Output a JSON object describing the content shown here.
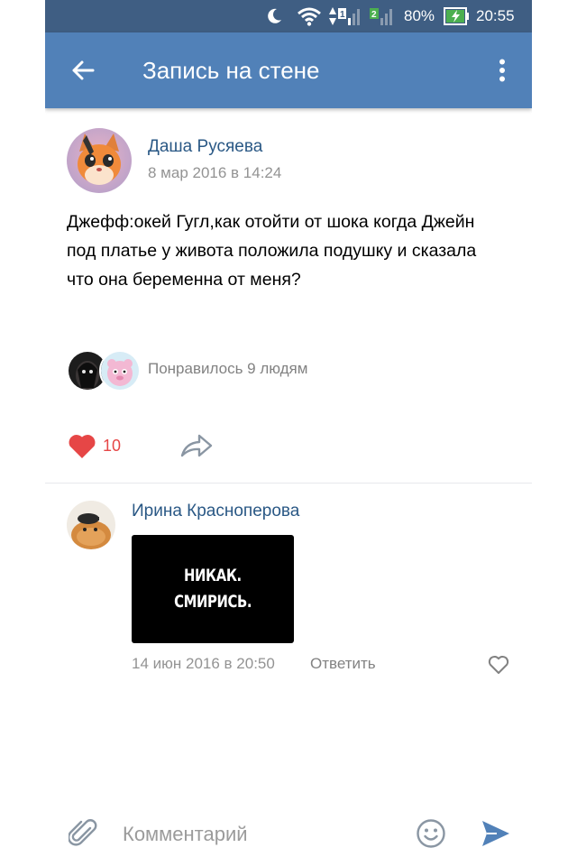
{
  "status_bar": {
    "battery": "80%",
    "time": "20:55"
  },
  "header": {
    "title": "Запись на стене"
  },
  "post": {
    "author": "Даша Русяева",
    "date": "8 мар 2016 в 14:24",
    "text": "Джефф:окей Гугл,как отойти от шока когда Джейн под платье у живота положила подушку и сказала что она беременна от меня?",
    "likes_summary": "Понравилось 9 людям",
    "like_count": "10"
  },
  "comment": {
    "author": "Ирина Красноперова",
    "image_text": [
      "НИКАК.",
      "СМИРИСЬ."
    ],
    "date": "14 июн 2016 в 20:50",
    "reply_label": "Ответить"
  },
  "composer": {
    "placeholder": "Комментарий"
  },
  "colors": {
    "status_bar": "#3f5e83",
    "app_bar": "#5181b8",
    "link": "#2a5885",
    "like_active": "#e64646",
    "send": "#5181b8"
  },
  "icons": {
    "back": "arrow-left-icon",
    "more": "more-vertical-icon",
    "like": "heart-icon",
    "share": "share-icon",
    "comment_like": "heart-outline-icon",
    "attach": "paperclip-icon",
    "emoji": "emoji-icon",
    "send": "send-icon"
  }
}
